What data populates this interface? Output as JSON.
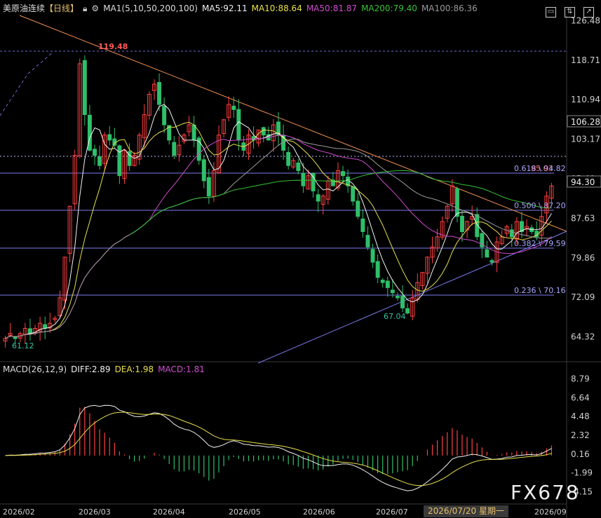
{
  "header": {
    "title": "美原油连续",
    "period": "【日线】",
    "lock_icon": "lock-icon",
    "settings_icon": "settings-icon",
    "ma_label": "MA1(5,10,50,200,100)",
    "ma5": "MA5:92.11",
    "ma10": "MA10:88.64",
    "ma50": "MA50:81.87",
    "ma200": "MA200:79.40",
    "ma100": "MA100:86.36",
    "colors": {
      "ma5": "#f2f2f2",
      "ma10": "#e8e04a",
      "ma50": "#d04bd0",
      "ma200": "#36c236",
      "ma100": "#9a9a9a"
    }
  },
  "toolbar": {
    "icons": [
      "monitor-icon",
      "chart-toggle-icon",
      "maximize-icon"
    ]
  },
  "macd_header": {
    "label": "MACD(26,12,9)",
    "diff": "DIFF:2.89",
    "dea": "DEA:1.98",
    "macd": "MACD:1.81"
  },
  "crosshair_date": "2026/07/20 星期一",
  "watermark": "FX678",
  "chart_data": [
    {
      "type": "candlestick",
      "y_axis_ticks": [
        "126.48",
        "118.71",
        "110.94",
        "103.17",
        "95.40",
        "87.63",
        "79.86",
        "72.09",
        "64.32"
      ],
      "ylim": [
        60.0,
        127.5
      ],
      "x_axis_ticks": [
        "2026/02",
        "2026/03",
        "2026/04",
        "2026/05",
        "2026/06",
        "2026/07",
        "2026/09"
      ],
      "price_tags": {
        "last": "94.30",
        "high_line": "106.28"
      },
      "annotations": {
        "high": "119.48",
        "lows": [
          "61.12",
          "67.04"
        ],
        "last_high": "95.03"
      },
      "fib_levels": [
        {
          "label": "0.618 \\ 94.82",
          "value": 94.82
        },
        {
          "label": "0.500 \\ 87.20",
          "value": 87.2
        },
        {
          "label": "0.382 \\ 79.59",
          "value": 79.59
        },
        {
          "label": "0.236 \\ 70.16",
          "value": 70.16
        }
      ],
      "close_series": [
        64,
        65,
        64,
        65,
        66,
        65,
        66,
        67,
        66,
        67,
        68,
        72,
        80,
        90,
        100,
        118,
        108,
        101,
        100,
        98,
        104,
        103,
        102,
        96,
        101,
        98,
        100,
        104,
        108,
        112,
        114,
        110,
        106,
        103,
        100,
        102,
        104,
        106,
        103,
        99,
        95,
        92,
        97,
        104,
        107,
        110,
        109,
        103,
        101,
        104,
        103,
        105,
        104,
        103,
        106,
        104,
        101,
        98,
        99,
        97,
        94,
        96,
        93,
        91,
        92,
        95,
        94,
        97,
        96,
        94,
        91,
        88,
        85,
        82,
        79,
        76,
        75,
        74,
        73,
        72,
        70,
        69,
        72,
        75,
        77,
        80,
        82,
        84,
        87,
        90,
        94,
        88,
        85,
        87,
        88,
        84,
        82,
        80,
        79,
        83,
        84,
        86,
        84,
        87,
        85,
        86,
        85,
        84,
        88,
        92,
        94
      ]
    },
    {
      "type": "macd",
      "y_axis_ticks": [
        "8.79",
        "6.64",
        "4.48",
        "2.32",
        "0.16",
        "-1.99",
        "-4.15"
      ],
      "ylim": [
        -5.0,
        9.0
      ]
    }
  ]
}
